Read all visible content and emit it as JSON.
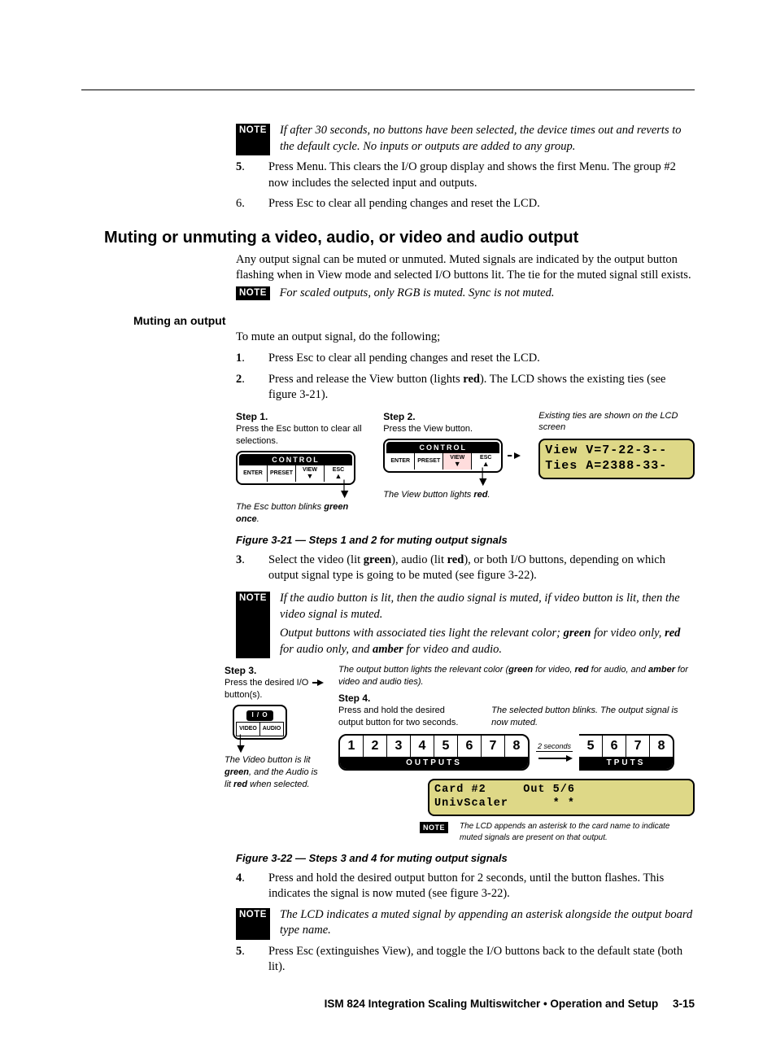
{
  "note_label": "NOTE",
  "top_note": "If after 30 seconds, no buttons have been selected, the device times out and reverts to the default cycle.  No inputs or outputs are added to any group.",
  "step5a_n": "5",
  "step5a": "Press Menu.  This clears the I/O group display and shows the first Menu.  The group #2 now includes the selected input and outputs.",
  "step6a_n": "6.",
  "step6a": "Press Esc to clear all pending changes and reset the LCD.",
  "h1": "Muting or unmuting a video, audio, or video and audio output",
  "h1_body": "Any output signal can be muted or unmuted.  Muted signals are indicated by the output button flashing when in View mode and selected I/O buttons lit.  The tie for the muted signal still exists.",
  "h1_note": "For scaled outputs, only RGB is muted.  Sync is not muted.",
  "h2": "Muting an output",
  "h2_lead": "To mute an output signal, do the following;",
  "m1_n": "1",
  "m1": "Press Esc to clear all pending changes and reset the LCD.",
  "m2_n": "2",
  "m2_a": "Press and release the View button (lights ",
  "m2_b": "red",
  "m2_c": ").  The LCD shows the existing ties (see figure 3-21).",
  "fig21": {
    "s1_head": "Step 1.",
    "s1_txt": "Press the Esc button to clear all selections.",
    "s2_head": "Step 2.",
    "s2_txt": "Press the View button.",
    "rhs_txt": "Existing ties are shown on the LCD screen",
    "ctrl_label": "CONTROL",
    "enter": "ENTER",
    "preset": "PRESET",
    "view": "VIEW",
    "esc": "ESC",
    "lcd_l1": "View V=7-22-3--",
    "lcd_l2": "Ties A=2388-33-",
    "esc_note_a": "The Esc button blinks ",
    "esc_note_b": "green once",
    "view_note_a": "The View button lights ",
    "view_note_b": "red"
  },
  "fig21_caption": "Figure 3-21 — Steps 1 and 2 for muting output signals",
  "m3_n": "3",
  "m3_a": "Select the video (lit ",
  "m3_b": "green",
  "m3_c": "), audio (lit ",
  "m3_d": "red",
  "m3_e": "), or both I/O buttons, depending on which output signal type is going to be muted (see figure 3-22).",
  "note3a": "If the audio button is lit, then the audio signal is muted, if video button is lit, then the video signal is muted.",
  "note3b_a": "Output buttons with associated ties light the relevant color; ",
  "note3b_b": "green",
  "note3b_c": " for video only, ",
  "note3b_d": "red",
  "note3b_e": " for audio only, and ",
  "note3b_f": "amber",
  "note3b_g": " for video and audio.",
  "fig22": {
    "s3_head": "Step 3.",
    "s3_txt": "Press the desired I/O button(s).",
    "s3_note_a": "The Video button is lit ",
    "s3_note_b": "green",
    "s3_note_c": ", and the Audio is lit ",
    "s3_note_d": "red",
    "s3_note_e": " when selected.",
    "io_label": "I / O",
    "video": "VIDEO",
    "audio": "AUDIO",
    "top_note_a": "The output button lights the relevant color (",
    "top_note_b": "green",
    "top_note_c": " for video, ",
    "top_note_d": "red",
    "top_note_e": " for audio, and ",
    "top_note_f": "amber",
    "top_note_g": " for video and audio ties).",
    "s4_head": "Step 4.",
    "s4_txt": "Press and hold the desired output button for two seconds.",
    "rhs_txt": "The selected button blinks. The output signal is now muted.",
    "two_sec": "2 seconds",
    "outputs": [
      "1",
      "2",
      "3",
      "4",
      "5",
      "6",
      "7",
      "8"
    ],
    "outputs2": [
      "5",
      "6",
      "7",
      "8"
    ],
    "outputs_label": "OUTPUTS",
    "outputs_label2": "TPUTS",
    "lcd2_l1": "Card #2     Out 5/6",
    "lcd2_l2": "UnivScaler      * *",
    "foot_note": "The LCD appends an asterisk to the card name to indicate muted signals are present on that output."
  },
  "fig22_caption": "Figure 3-22 — Steps 3 and 4 for muting output signals",
  "m4_n": "4",
  "m4": "Press and hold the desired output button for 2 seconds, until the button flashes.  This indicates the signal is now muted (see figure 3-22).",
  "note4": "The LCD indicates a muted signal by appending an asterisk alongside the output board type name.",
  "m5_n": "5",
  "m5": "Press Esc (extinguishes View), and toggle the I/O buttons back to the default state (both lit).",
  "footer_a": "ISM 824 Integration Scaling Multiswitcher • Operation and Setup",
  "footer_b": "3-15"
}
